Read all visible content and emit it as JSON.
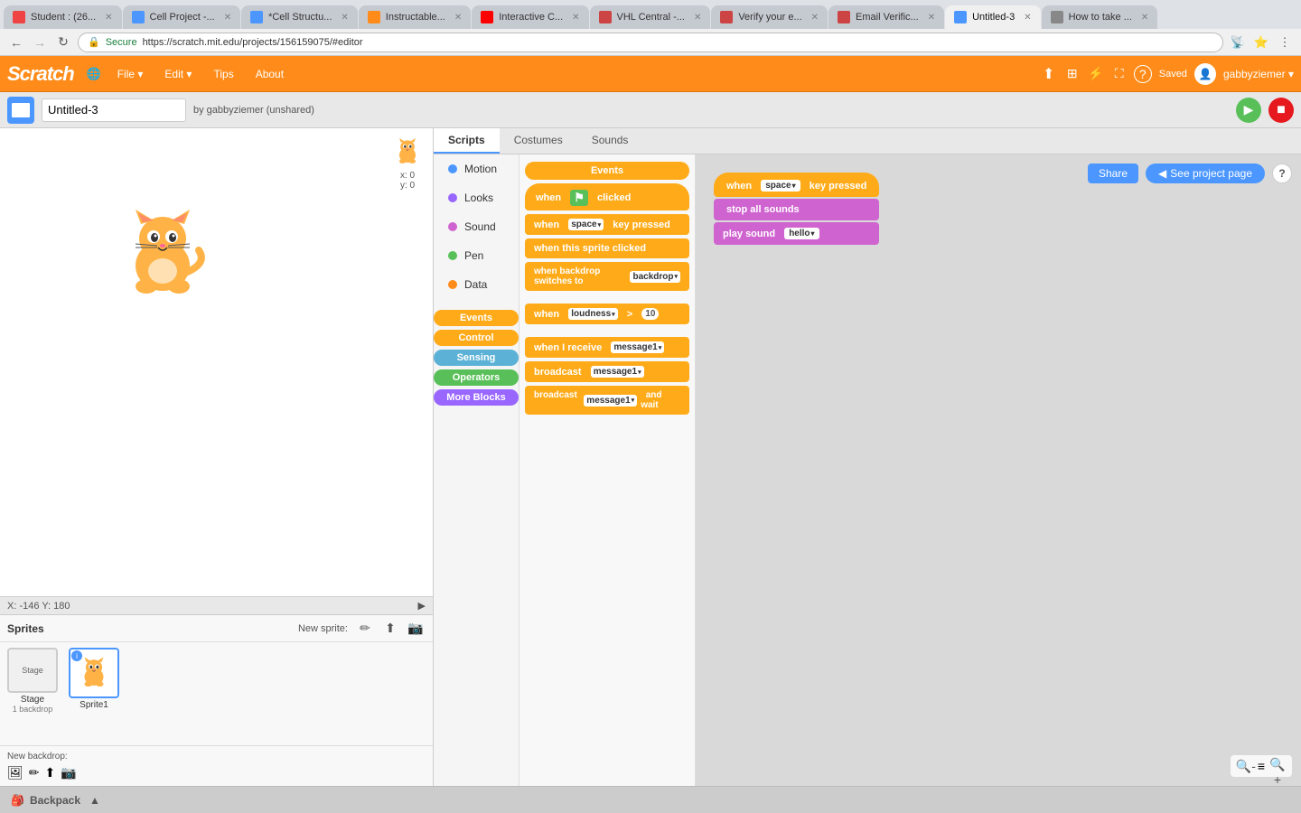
{
  "browser": {
    "tabs": [
      {
        "id": "t1",
        "title": "Student : (26...",
        "favicon_color": "#e44",
        "active": false
      },
      {
        "id": "t2",
        "title": "Cell Project -...",
        "favicon_color": "#4c97ff",
        "active": false
      },
      {
        "id": "t3",
        "title": "*Cell Structu...",
        "favicon_color": "#4c97ff",
        "active": false
      },
      {
        "id": "t4",
        "title": "Instructable...",
        "favicon_color": "#ff8c1a",
        "active": false
      },
      {
        "id": "t5",
        "title": "Interactive C...",
        "favicon_color": "#f00",
        "active": false
      },
      {
        "id": "t6",
        "title": "VHL Central -...",
        "favicon_color": "#c44",
        "active": false
      },
      {
        "id": "t7",
        "title": "Verify your e...",
        "favicon_color": "#c44",
        "active": false
      },
      {
        "id": "t8",
        "title": "Email Verific...",
        "favicon_color": "#c44",
        "active": false
      },
      {
        "id": "t9",
        "title": "Untitled-3",
        "favicon_color": "#4c97ff",
        "active": true
      },
      {
        "id": "t10",
        "title": "How to take ...",
        "favicon_color": "#888",
        "active": false
      }
    ],
    "url": "https://scratch.mit.edu/projects/156159075/#editor",
    "secure_text": "Secure"
  },
  "header": {
    "logo_text": "SCRATCH",
    "menu_items": [
      "File ▾",
      "Edit ▾",
      "Tips",
      "About"
    ],
    "save_status": "Saved",
    "user": "gabbyziemer ▾",
    "share_label": "Share",
    "see_project_label": "See project page"
  },
  "controls": {
    "project_name": "Untitled-3",
    "by_user": "by gabbyziemer (unshared)"
  },
  "scripts_panel": {
    "tabs": [
      "Scripts",
      "Costumes",
      "Sounds"
    ],
    "active_tab": "Scripts",
    "categories": [
      {
        "name": "Motion",
        "color": "#4c97ff"
      },
      {
        "name": "Looks",
        "color": "#9966ff"
      },
      {
        "name": "Sound",
        "color": "#cf63cf"
      },
      {
        "name": "Pen",
        "color": "#59c059"
      },
      {
        "name": "Data",
        "color": "#ff8c1a"
      }
    ],
    "block_sections": [
      {
        "name": "Events",
        "color": "#ffab19"
      },
      {
        "name": "Control",
        "color": "#ffab19"
      },
      {
        "name": "Sensing",
        "color": "#5cb1d6"
      },
      {
        "name": "Operators",
        "color": "#59c059"
      },
      {
        "name": "More Blocks",
        "color": "#9966ff"
      }
    ],
    "palette_blocks": [
      {
        "type": "when_flag",
        "text": "when  clicked"
      },
      {
        "type": "when_key",
        "text": "when  space ▾  key pressed"
      },
      {
        "type": "when_sprite",
        "text": "when this sprite clicked"
      },
      {
        "type": "when_backdrop",
        "text": "when backdrop switches to  backdrop"
      },
      {
        "type": "when_loudness",
        "text": "when  loudness ▾  >  10"
      },
      {
        "type": "when_receive",
        "text": "when I receive  message1 ▾"
      },
      {
        "type": "broadcast",
        "text": "broadcast  message1 ▾"
      },
      {
        "type": "broadcast_wait",
        "text": "broadcast  message1 ▾  and wait"
      }
    ]
  },
  "canvas_blocks": {
    "group1": {
      "hat": "when  space ▾  key pressed",
      "blocks": [
        {
          "type": "sound",
          "text": "stop all sounds"
        },
        {
          "type": "sound",
          "text": "play sound  hello ▾"
        }
      ]
    }
  },
  "stage": {
    "coords": "X: -146  Y: 180",
    "x_label": "x:",
    "x_val": "0",
    "y_label": "y:",
    "y_val": "0"
  },
  "sprites": {
    "title": "Sprites",
    "new_sprite_label": "New sprite:",
    "list": [
      {
        "name": "Stage",
        "sub": "1 backdrop",
        "type": "stage"
      },
      {
        "name": "Sprite1",
        "type": "sprite",
        "selected": true
      }
    ],
    "new_backdrop_label": "New backdrop:"
  },
  "backpack": {
    "label": "Backpack"
  }
}
